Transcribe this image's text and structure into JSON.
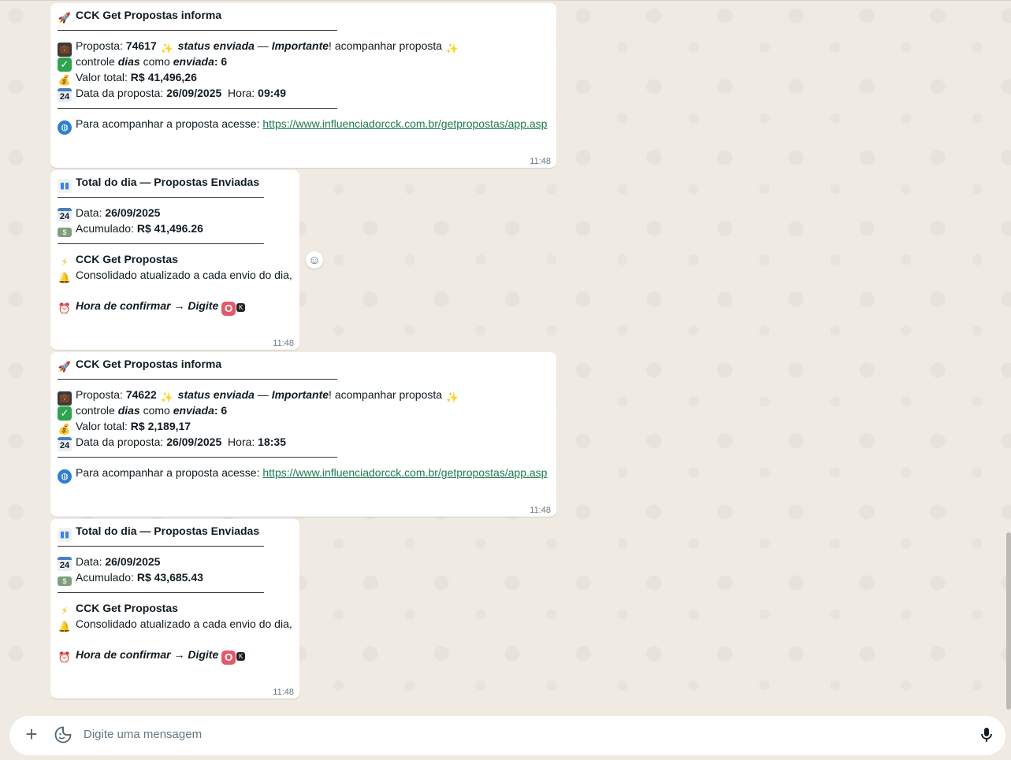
{
  "chat": {
    "messages": [
      {
        "type": "info",
        "header": "CCK Get Propostas informa",
        "proposta_label": "Proposta: ",
        "proposta_num": "74617",
        "status_text": "status enviada",
        "dash": " — ",
        "importante": "Importante",
        "acompanhar": "! acompanhar proposta",
        "controle_label": "controle ",
        "dias": "dias",
        "como": " como ",
        "enviada": "enviada",
        "dias_value": ": 6",
        "valor_label": "Valor total: ",
        "valor": "R$ 41,496,26",
        "data_label": "Data da proposta: ",
        "data": "26/09/2025",
        "hora_label": "  Hora: ",
        "hora": "09:49",
        "acesse_label": "Para acompanhar a proposta acesse: ",
        "link": "https://www.influenciadorcck.com.br/getpropostas/app.asp",
        "time": "11:48"
      },
      {
        "type": "total",
        "header": "Total do dia — Propostas Enviadas",
        "data_label": "Data: ",
        "data": "26/09/2025",
        "acumulado_label": "Acumulado: ",
        "acumulado": "R$ 41,496.26",
        "brand": "CCK Get Propostas",
        "consolidado": "Consolidado atualizado a cada envio do dia,",
        "confirmar": "Hora de confirmar → Digite",
        "time": "11:48"
      },
      {
        "type": "info",
        "header": "CCK Get Propostas informa",
        "proposta_label": "Proposta: ",
        "proposta_num": "74622",
        "status_text": "status enviada",
        "dash": " — ",
        "importante": "Importante",
        "acompanhar": "! acompanhar proposta",
        "controle_label": "controle ",
        "dias": "dias",
        "como": " como ",
        "enviada": "enviada",
        "dias_value": ": 6",
        "valor_label": "Valor total: ",
        "valor": "R$ 2,189,17",
        "data_label": "Data da proposta: ",
        "data": "26/09/2025",
        "hora_label": "  Hora: ",
        "hora": "18:35",
        "acesse_label": "Para acompanhar a proposta acesse: ",
        "link": "https://www.influenciadorcck.com.br/getpropostas/app.asp",
        "time": "11:48"
      },
      {
        "type": "total",
        "header": "Total do dia — Propostas Enviadas",
        "data_label": "Data: ",
        "data": "26/09/2025",
        "acumulado_label": "Acumulado: ",
        "acumulado": "R$ 43,685.43",
        "brand": "CCK Get Propostas",
        "consolidado": "Consolidado atualizado a cada envio do dia,",
        "confirmar": "Hora de confirmar → Digite",
        "time": "11:48"
      }
    ],
    "calendar_day": "24",
    "ok_o": "O",
    "ok_k": "K"
  },
  "composer": {
    "placeholder": "Digite uma mensagem"
  },
  "icons": {
    "rocket": "rocket-icon",
    "briefcase": "briefcase-icon",
    "sparkles": "sparkles-icon",
    "check": "check-icon",
    "money_bag": "money-bag-icon",
    "calendar": "calendar-icon",
    "globe": "globe-icon",
    "chart": "bar-chart-icon",
    "banknote": "banknote-icon",
    "lightning": "lightning-icon",
    "bell": "bell-icon",
    "alarm": "alarm-clock-icon"
  },
  "colors": {
    "chat_bg": "#efeae2",
    "bubble_bg": "#ffffff",
    "link": "#1d7a4e",
    "check_green": "#2ea44f",
    "ok_red": "#e05a6a"
  }
}
